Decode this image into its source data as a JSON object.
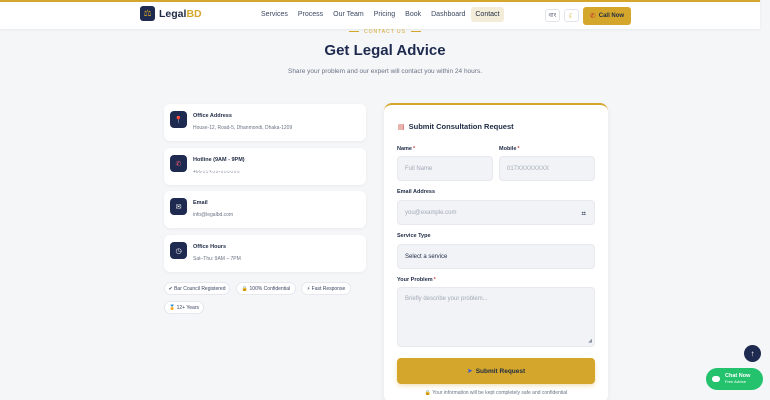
{
  "header": {
    "logo_text": "Legal",
    "logo_accent": "BD",
    "logo_icon": "scales-icon",
    "nav": [
      "Services",
      "Process",
      "Our Team",
      "Pricing",
      "Book",
      "Dashboard",
      "Contact"
    ],
    "active_nav": "Contact",
    "lang_label": "বাং",
    "theme_icon": "moon-icon",
    "call_label": "Call Now"
  },
  "hero": {
    "eyebrow": "CONTACT US",
    "title": "Get Legal Advice",
    "subtitle": "Share your problem and our expert will contact you within 24 hours."
  },
  "contact_info": [
    {
      "icon": "map-pin-icon",
      "label": "Office Address",
      "value": "House-12, Road-5, Dhanmondi, Dhaka-1209"
    },
    {
      "icon": "phone-icon",
      "label": "Hotline (9AM - 9PM)",
      "value": "+৮৮০১৭০০-০০০০০০"
    },
    {
      "icon": "envelope-icon",
      "label": "Email",
      "value": "info@legalbd.com"
    },
    {
      "icon": "clock-icon",
      "label": "Office Hours",
      "value": "Sat–Thu: 9AM – 7PM"
    }
  ],
  "badges": [
    "✔ Bar Council Registered",
    "🔒 100% Confidential",
    "⚡ Fast Response",
    "🏅 12+ Years"
  ],
  "form": {
    "title": "Submit Consultation Request",
    "name_label": "Name",
    "name_placeholder": "Full Name",
    "mobile_label": "Mobile",
    "mobile_placeholder": "017XXXXXXXX",
    "email_label": "Email Address",
    "email_placeholder": "you@example.com",
    "service_label": "Service Type",
    "service_selected": "Select a service",
    "problem_label": "Your Problem",
    "problem_placeholder": "Briefly describe your problem...",
    "submit_label": "Submit Request",
    "safe_note": "🔒 Your information will be kept completely safe and confidential"
  },
  "floating": {
    "chat_title": "Chat Now",
    "chat_sub": "Free Advice"
  },
  "colors": {
    "accent": "#d4a72c",
    "navy": "#1e2a4f",
    "chat_green": "#25c26e"
  }
}
